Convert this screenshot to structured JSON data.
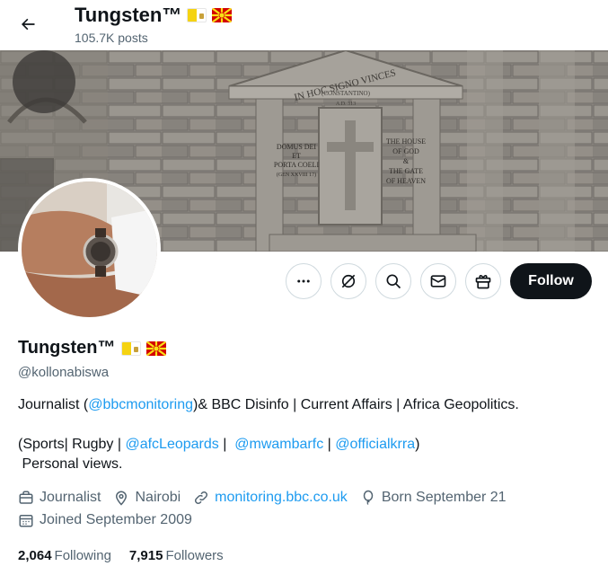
{
  "header": {
    "title": "Tungsten™",
    "post_count": "105.7K posts"
  },
  "profile": {
    "name": "Tungsten™",
    "handle": "@kollonabiswa",
    "follow_label": "Follow"
  },
  "banner": {
    "inscription_arc": "IN HOC SIGNO VINCES",
    "inscription_arc_sub": "(CONSTANTINO)",
    "inscription_year": "A.D. 313",
    "left_plaque": [
      "DOMUS DEI",
      "ET",
      "PORTA COELI",
      "(GEN XXVIII 17)"
    ],
    "right_plaque": [
      "THE HOUSE",
      "OF GOD",
      "&",
      "THE GATE",
      "OF HEAVEN"
    ]
  },
  "bio": {
    "line1_pre": "Journalist (",
    "line1_link": "@bbcmonitoring",
    "line1_post": ")& BBC Disinfo | Current Affairs | Africa Geopolitics.",
    "line3_pre": "(Sports| Rugby | ",
    "line3_link1": "@afcLeopards",
    "line3_sep1": " |  ",
    "line3_link2": "@mwambarfc",
    "line3_sep2": " | ",
    "line3_link3": "@officialkrra",
    "line3_post": ")",
    "line4": " Personal views."
  },
  "meta": {
    "profession": "Journalist",
    "location": "Nairobi",
    "website": "monitoring.bbc.co.uk",
    "birthday": "Born September 21",
    "joined": "Joined September 2009"
  },
  "stats": {
    "following_count": "2,064",
    "following_label": "Following",
    "followers_count": "7,915",
    "followers_label": "Followers"
  },
  "icons": {
    "back": "back-arrow-icon",
    "more": "more-icon",
    "grok": "grok-icon",
    "search": "search-icon",
    "message": "message-icon",
    "gift": "gift-icon"
  },
  "colors": {
    "link": "#1d9bf0",
    "text": "#0f1419",
    "secondary": "#536471",
    "follow_bg": "#0f1419"
  }
}
